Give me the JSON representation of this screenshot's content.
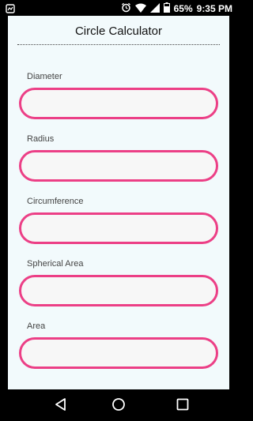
{
  "status": {
    "battery": "65%",
    "time": "9:35 PM",
    "icons": [
      "notification-icon",
      "alarm-icon",
      "wifi-icon",
      "signal-icon",
      "battery-icon"
    ]
  },
  "app": {
    "title": "Circle Calculator",
    "fields": [
      {
        "label": "Diameter",
        "value": ""
      },
      {
        "label": "Radius",
        "value": ""
      },
      {
        "label": "Circumference",
        "value": ""
      },
      {
        "label": "Spherical Area",
        "value": ""
      },
      {
        "label": "Area",
        "value": ""
      }
    ]
  },
  "nav": {
    "icons": [
      "back-icon",
      "home-icon",
      "recents-icon"
    ]
  },
  "colors": {
    "accent": "#ec3f86",
    "card": "#f2fafc",
    "input_bg": "#f7f7f7"
  }
}
